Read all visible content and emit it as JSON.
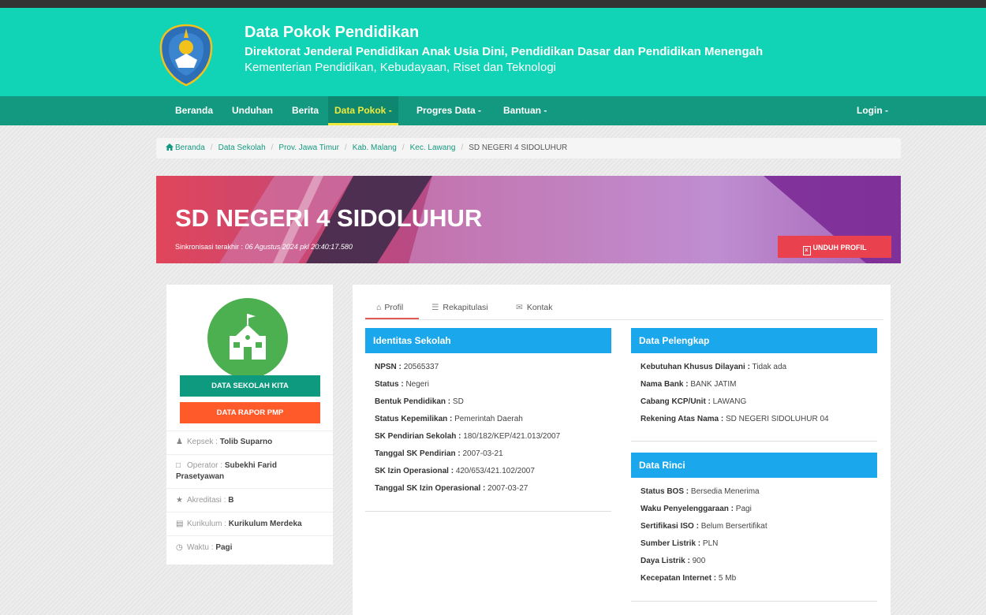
{
  "header": {
    "title": "Data Pokok Pendidikan",
    "subtitle": "Direktorat Jenderal Pendidikan Anak Usia Dini, Pendidikan Dasar dan Pendidikan Menengah",
    "ministry": "Kementerian Pendidikan, Kebudayaan, Riset dan Teknologi",
    "logo_text": "TUT WURI HANDAYANI"
  },
  "nav": {
    "beranda": "Beranda",
    "unduhan": "Unduhan",
    "berita": "Berita",
    "data_pokok": "Data Pokok -",
    "progres": "Progres Data -",
    "bantuan": "Bantuan -",
    "login": "Login -"
  },
  "breadcrumb": [
    "Beranda",
    "Data Sekolah",
    "Prov. Jawa Timur",
    "Kab. Malang",
    "Kec. Lawang",
    "SD NEGERI 4 SIDOLUHUR"
  ],
  "banner": {
    "school_name": "SD NEGERI 4 SIDOLUHUR",
    "sync_label": "Sinkronisasi terakhir :",
    "sync_value": "06 Agustus 2024 pkl 20:40:17.580",
    "download_label": "UNDUH PROFIL"
  },
  "left": {
    "btn_sekolah_kita": "DATA SEKOLAH KITA",
    "btn_rapor": "DATA RAPOR PMP",
    "kepsek_label": "Kepsek :",
    "kepsek_value": "Tolib Suparno",
    "operator_label": "Operator :",
    "operator_value1": "Subekhi Farid",
    "operator_value2": "Prasetyawan",
    "akreditasi_label": "Akreditasi :",
    "akreditasi_value": "B",
    "kurikulum_label": "Kurikulum :",
    "kurikulum_value": "Kurikulum Merdeka",
    "waktu_label": "Waktu :",
    "waktu_value": "Pagi"
  },
  "tabs": {
    "profil": "Profil",
    "rekap": "Rekapitulasi",
    "kontak": "Kontak"
  },
  "identitas": {
    "title": "Identitas Sekolah",
    "fields": [
      {
        "label": "NPSN :",
        "value": "20565337"
      },
      {
        "label": "Status :",
        "value": "Negeri"
      },
      {
        "label": "Bentuk Pendidikan :",
        "value": "SD"
      },
      {
        "label": "Status Kepemilikan :",
        "value": "Pemerintah Daerah"
      },
      {
        "label": "SK Pendirian Sekolah :",
        "value": "180/182/KEP/421.013/2007"
      },
      {
        "label": "Tanggal SK Pendirian :",
        "value": "2007-03-21"
      },
      {
        "label": "SK Izin Operasional :",
        "value": "420/653/421.102/2007"
      },
      {
        "label": "Tanggal SK Izin Operasional :",
        "value": "2007-03-27"
      }
    ]
  },
  "pelengkap": {
    "title": "Data Pelengkap",
    "fields": [
      {
        "label": "Kebutuhan Khusus Dilayani :",
        "value": "Tidak ada"
      },
      {
        "label": "Nama Bank :",
        "value": "BANK JATIM"
      },
      {
        "label": "Cabang KCP/Unit :",
        "value": "LAWANG"
      },
      {
        "label": "Rekening Atas Nama :",
        "value": "SD NEGERI SIDOLUHUR 04"
      }
    ]
  },
  "rinci": {
    "title": "Data Rinci",
    "fields": [
      {
        "label": "Status BOS :",
        "value": "Bersedia Menerima"
      },
      {
        "label": "Waku Penyelenggaraan :",
        "value": "Pagi"
      },
      {
        "label": "Sertifikasi ISO :",
        "value": "Belum Bersertifikat"
      },
      {
        "label": "Sumber Listrik :",
        "value": "PLN"
      },
      {
        "label": "Daya Listrik :",
        "value": "900"
      },
      {
        "label": "Kecepatan Internet :",
        "value": "5 Mb"
      }
    ]
  },
  "colors": {
    "header_bg": "#11d3b5",
    "nav_bg": "#13997f",
    "nav_active": "#f1e93c",
    "panel_head": "#1aa7ec",
    "download_btn": "#e9424e",
    "btn_green": "#0e9a7f",
    "btn_orange": "#ff5a2a"
  }
}
